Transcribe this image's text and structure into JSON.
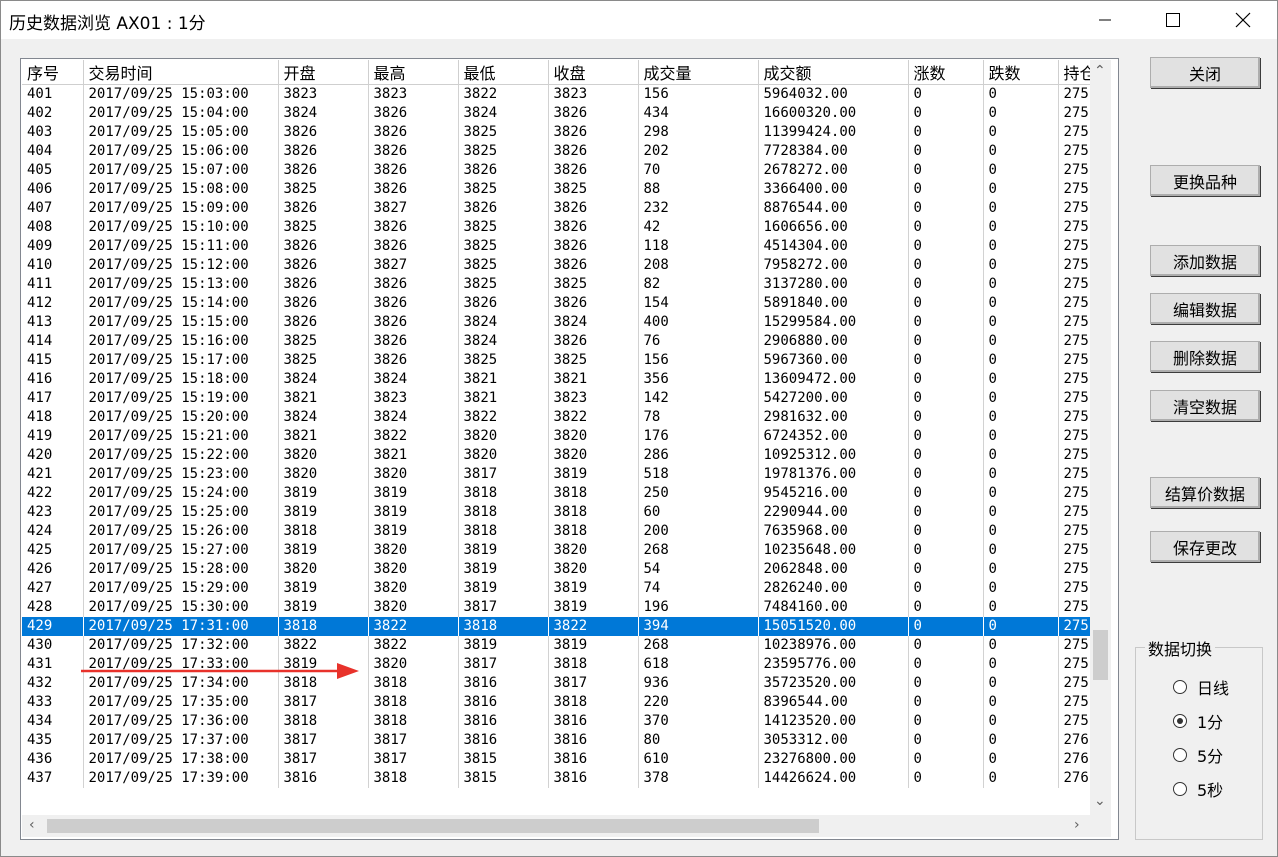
{
  "window": {
    "title": "历史数据浏览 AX01 : 1分"
  },
  "table": {
    "columns": [
      "序号",
      "交易时间",
      "开盘",
      "最高",
      "最低",
      "收盘",
      "成交量",
      "成交额",
      "涨数",
      "跌数",
      "持仓"
    ],
    "selected_row": 28,
    "rows": [
      [
        "401",
        "2017/09/25 15:03:00",
        "3823",
        "3823",
        "3822",
        "3823",
        "156",
        "5964032.00",
        "0",
        "0",
        "275"
      ],
      [
        "402",
        "2017/09/25 15:04:00",
        "3824",
        "3826",
        "3824",
        "3826",
        "434",
        "16600320.00",
        "0",
        "0",
        "275"
      ],
      [
        "403",
        "2017/09/25 15:05:00",
        "3826",
        "3826",
        "3825",
        "3826",
        "298",
        "11399424.00",
        "0",
        "0",
        "275"
      ],
      [
        "404",
        "2017/09/25 15:06:00",
        "3826",
        "3826",
        "3825",
        "3826",
        "202",
        "7728384.00",
        "0",
        "0",
        "275"
      ],
      [
        "405",
        "2017/09/25 15:07:00",
        "3826",
        "3826",
        "3826",
        "3826",
        "70",
        "2678272.00",
        "0",
        "0",
        "275"
      ],
      [
        "406",
        "2017/09/25 15:08:00",
        "3825",
        "3826",
        "3825",
        "3825",
        "88",
        "3366400.00",
        "0",
        "0",
        "275"
      ],
      [
        "407",
        "2017/09/25 15:09:00",
        "3826",
        "3827",
        "3826",
        "3826",
        "232",
        "8876544.00",
        "0",
        "0",
        "275"
      ],
      [
        "408",
        "2017/09/25 15:10:00",
        "3825",
        "3826",
        "3825",
        "3826",
        "42",
        "1606656.00",
        "0",
        "0",
        "275"
      ],
      [
        "409",
        "2017/09/25 15:11:00",
        "3826",
        "3826",
        "3825",
        "3826",
        "118",
        "4514304.00",
        "0",
        "0",
        "275"
      ],
      [
        "410",
        "2017/09/25 15:12:00",
        "3826",
        "3827",
        "3825",
        "3826",
        "208",
        "7958272.00",
        "0",
        "0",
        "275"
      ],
      [
        "411",
        "2017/09/25 15:13:00",
        "3826",
        "3826",
        "3825",
        "3825",
        "82",
        "3137280.00",
        "0",
        "0",
        "275"
      ],
      [
        "412",
        "2017/09/25 15:14:00",
        "3826",
        "3826",
        "3826",
        "3826",
        "154",
        "5891840.00",
        "0",
        "0",
        "275"
      ],
      [
        "413",
        "2017/09/25 15:15:00",
        "3826",
        "3826",
        "3824",
        "3824",
        "400",
        "15299584.00",
        "0",
        "0",
        "275"
      ],
      [
        "414",
        "2017/09/25 15:16:00",
        "3825",
        "3826",
        "3824",
        "3826",
        "76",
        "2906880.00",
        "0",
        "0",
        "275"
      ],
      [
        "415",
        "2017/09/25 15:17:00",
        "3825",
        "3826",
        "3825",
        "3825",
        "156",
        "5967360.00",
        "0",
        "0",
        "275"
      ],
      [
        "416",
        "2017/09/25 15:18:00",
        "3824",
        "3824",
        "3821",
        "3821",
        "356",
        "13609472.00",
        "0",
        "0",
        "275"
      ],
      [
        "417",
        "2017/09/25 15:19:00",
        "3821",
        "3823",
        "3821",
        "3823",
        "142",
        "5427200.00",
        "0",
        "0",
        "275"
      ],
      [
        "418",
        "2017/09/25 15:20:00",
        "3824",
        "3824",
        "3822",
        "3822",
        "78",
        "2981632.00",
        "0",
        "0",
        "275"
      ],
      [
        "419",
        "2017/09/25 15:21:00",
        "3821",
        "3822",
        "3820",
        "3820",
        "176",
        "6724352.00",
        "0",
        "0",
        "275"
      ],
      [
        "420",
        "2017/09/25 15:22:00",
        "3820",
        "3821",
        "3820",
        "3820",
        "286",
        "10925312.00",
        "0",
        "0",
        "275"
      ],
      [
        "421",
        "2017/09/25 15:23:00",
        "3820",
        "3820",
        "3817",
        "3819",
        "518",
        "19781376.00",
        "0",
        "0",
        "275"
      ],
      [
        "422",
        "2017/09/25 15:24:00",
        "3819",
        "3819",
        "3818",
        "3818",
        "250",
        "9545216.00",
        "0",
        "0",
        "275"
      ],
      [
        "423",
        "2017/09/25 15:25:00",
        "3819",
        "3819",
        "3818",
        "3818",
        "60",
        "2290944.00",
        "0",
        "0",
        "275"
      ],
      [
        "424",
        "2017/09/25 15:26:00",
        "3818",
        "3819",
        "3818",
        "3818",
        "200",
        "7635968.00",
        "0",
        "0",
        "275"
      ],
      [
        "425",
        "2017/09/25 15:27:00",
        "3819",
        "3820",
        "3819",
        "3820",
        "268",
        "10235648.00",
        "0",
        "0",
        "275"
      ],
      [
        "426",
        "2017/09/25 15:28:00",
        "3820",
        "3820",
        "3819",
        "3820",
        "54",
        "2062848.00",
        "0",
        "0",
        "275"
      ],
      [
        "427",
        "2017/09/25 15:29:00",
        "3819",
        "3820",
        "3819",
        "3819",
        "74",
        "2826240.00",
        "0",
        "0",
        "275"
      ],
      [
        "428",
        "2017/09/25 15:30:00",
        "3819",
        "3820",
        "3817",
        "3819",
        "196",
        "7484160.00",
        "0",
        "0",
        "275"
      ],
      [
        "429",
        "2017/09/25 17:31:00",
        "3818",
        "3822",
        "3818",
        "3822",
        "394",
        "15051520.00",
        "0",
        "0",
        "275"
      ],
      [
        "430",
        "2017/09/25 17:32:00",
        "3822",
        "3822",
        "3819",
        "3819",
        "268",
        "10238976.00",
        "0",
        "0",
        "275"
      ],
      [
        "431",
        "2017/09/25 17:33:00",
        "3819",
        "3820",
        "3817",
        "3818",
        "618",
        "23595776.00",
        "0",
        "0",
        "275"
      ],
      [
        "432",
        "2017/09/25 17:34:00",
        "3818",
        "3818",
        "3816",
        "3817",
        "936",
        "35723520.00",
        "0",
        "0",
        "275"
      ],
      [
        "433",
        "2017/09/25 17:35:00",
        "3817",
        "3818",
        "3816",
        "3818",
        "220",
        "8396544.00",
        "0",
        "0",
        "275"
      ],
      [
        "434",
        "2017/09/25 17:36:00",
        "3818",
        "3818",
        "3816",
        "3816",
        "370",
        "14123520.00",
        "0",
        "0",
        "275"
      ],
      [
        "435",
        "2017/09/25 17:37:00",
        "3817",
        "3817",
        "3816",
        "3816",
        "80",
        "3053312.00",
        "0",
        "0",
        "276"
      ],
      [
        "436",
        "2017/09/25 17:38:00",
        "3817",
        "3817",
        "3815",
        "3816",
        "610",
        "23276800.00",
        "0",
        "0",
        "276"
      ],
      [
        "437",
        "2017/09/25 17:39:00",
        "3816",
        "3818",
        "3815",
        "3816",
        "378",
        "14426624.00",
        "0",
        "0",
        "276"
      ]
    ]
  },
  "buttons": {
    "close": "关闭",
    "change_symbol": "更换品种",
    "add": "添加数据",
    "edit": "编辑数据",
    "delete": "删除数据",
    "clear": "清空数据",
    "settlement": "结算价数据",
    "save": "保存更改"
  },
  "switch_group": {
    "title": "数据切换",
    "options": [
      "日线",
      "1分",
      "5分",
      "5秒"
    ],
    "selected": "1分"
  }
}
